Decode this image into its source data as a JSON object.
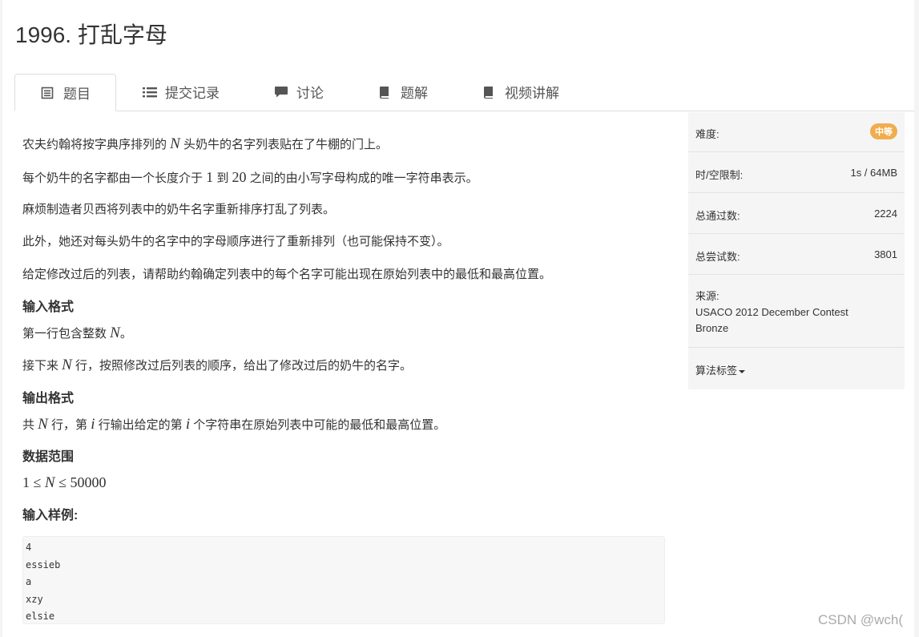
{
  "problem": {
    "title": "1996. 打乱字母"
  },
  "tabs": [
    {
      "label": "题目",
      "icon": "document-icon",
      "active": true
    },
    {
      "label": "提交记录",
      "icon": "list-icon"
    },
    {
      "label": "讨论",
      "icon": "comment-icon"
    },
    {
      "label": "题解",
      "icon": "book-icon"
    },
    {
      "label": "视频讲解",
      "icon": "book-icon"
    }
  ],
  "content": {
    "p1_pre": "农夫约翰将按字典序排列的 ",
    "p1_math": "N",
    "p1_post": " 头奶牛的名字列表贴在了牛棚的门上。",
    "p2_pre": "每个奶牛的名字都由一个长度介于 ",
    "p2_a": "1",
    "p2_mid": " 到 ",
    "p2_b": "20",
    "p2_post": " 之间的由小写字母构成的唯一字符串表示。",
    "p3": "麻烦制造者贝西将列表中的奶牛名字重新排序打乱了列表。",
    "p4": "此外，她还对每头奶牛的名字中的字母顺序进行了重新排列（也可能保持不变）。",
    "p5": "给定修改过后的列表，请帮助约翰确定列表中的每个名字可能出现在原始列表中的最低和最高位置。",
    "input_heading": "输入格式",
    "in1_pre": "第一行包含整数 ",
    "in1_math": "N",
    "in1_post": "。",
    "in2_pre": "接下来 ",
    "in2_math": "N",
    "in2_post": " 行，按照修改过后列表的顺序，给出了修改过后的奶牛的名字。",
    "output_heading": "输出格式",
    "out_pre": "共 ",
    "out_math1": "N",
    "out_mid1": " 行，第 ",
    "out_math2": "i",
    "out_mid2": " 行输出给定的第 ",
    "out_math3": "i",
    "out_post": " 个字符串在原始列表中可能的最低和最高位置。",
    "range_heading": "数据范围",
    "range_a": "1",
    "range_le1": " ≤ ",
    "range_n": "N",
    "range_le2": " ≤ ",
    "range_b": "50000",
    "sample_heading": "输入样例:",
    "sample_lines": [
      "4",
      "essieb",
      "a",
      "xzy",
      "elsie"
    ]
  },
  "sidebar": {
    "difficulty_label": "难度:",
    "difficulty_value": "中等",
    "limit_label": "时/空限制:",
    "limit_value": "1s / 64MB",
    "passed_label": "总通过数:",
    "passed_value": "2224",
    "attempts_label": "总尝试数:",
    "attempts_value": "3801",
    "source_label": "来源:",
    "source_value": "USACO 2012 December Contest Bronze",
    "tags_label": "算法标签"
  },
  "watermark": "CSDN @wch(",
  "colors": {
    "badge": "#f0ad4e",
    "sidebar_bg": "#f5f5f5"
  }
}
